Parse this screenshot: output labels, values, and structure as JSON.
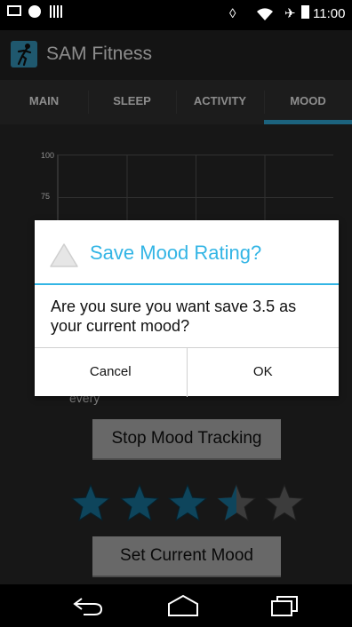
{
  "status_bar": {
    "time": "11:00",
    "icons": [
      "mail-icon",
      "motorola-icon",
      "barcode-icon",
      "vibrate-icon",
      "wifi-icon",
      "airplane-mode-icon",
      "battery-icon"
    ]
  },
  "app": {
    "title": "SAM Fitness",
    "icon": "fitness-figure-icon",
    "accent_color": "#33b5e5"
  },
  "tabs": [
    {
      "label": "MAIN",
      "active": false
    },
    {
      "label": "SLEEP",
      "active": false
    },
    {
      "label": "ACTIVITY",
      "active": false
    },
    {
      "label": "MOOD",
      "active": true
    }
  ],
  "chart": {
    "y_ticks": [
      "100",
      "75"
    ]
  },
  "mood": {
    "frequency_partial": "every",
    "stop_button": "Stop Mood Tracking",
    "set_button": "Set Current Mood",
    "rating": 3.5,
    "max_rating": 5,
    "star_color": "#1a7fa8"
  },
  "dialog": {
    "title": "Save Mood Rating?",
    "icon": "warning-icon",
    "message": "Are you sure you want save 3.5 as your current mood?",
    "cancel": "Cancel",
    "ok": "OK"
  },
  "nav_bar": {
    "icons": [
      "back-icon",
      "home-icon",
      "recent-apps-icon"
    ]
  }
}
